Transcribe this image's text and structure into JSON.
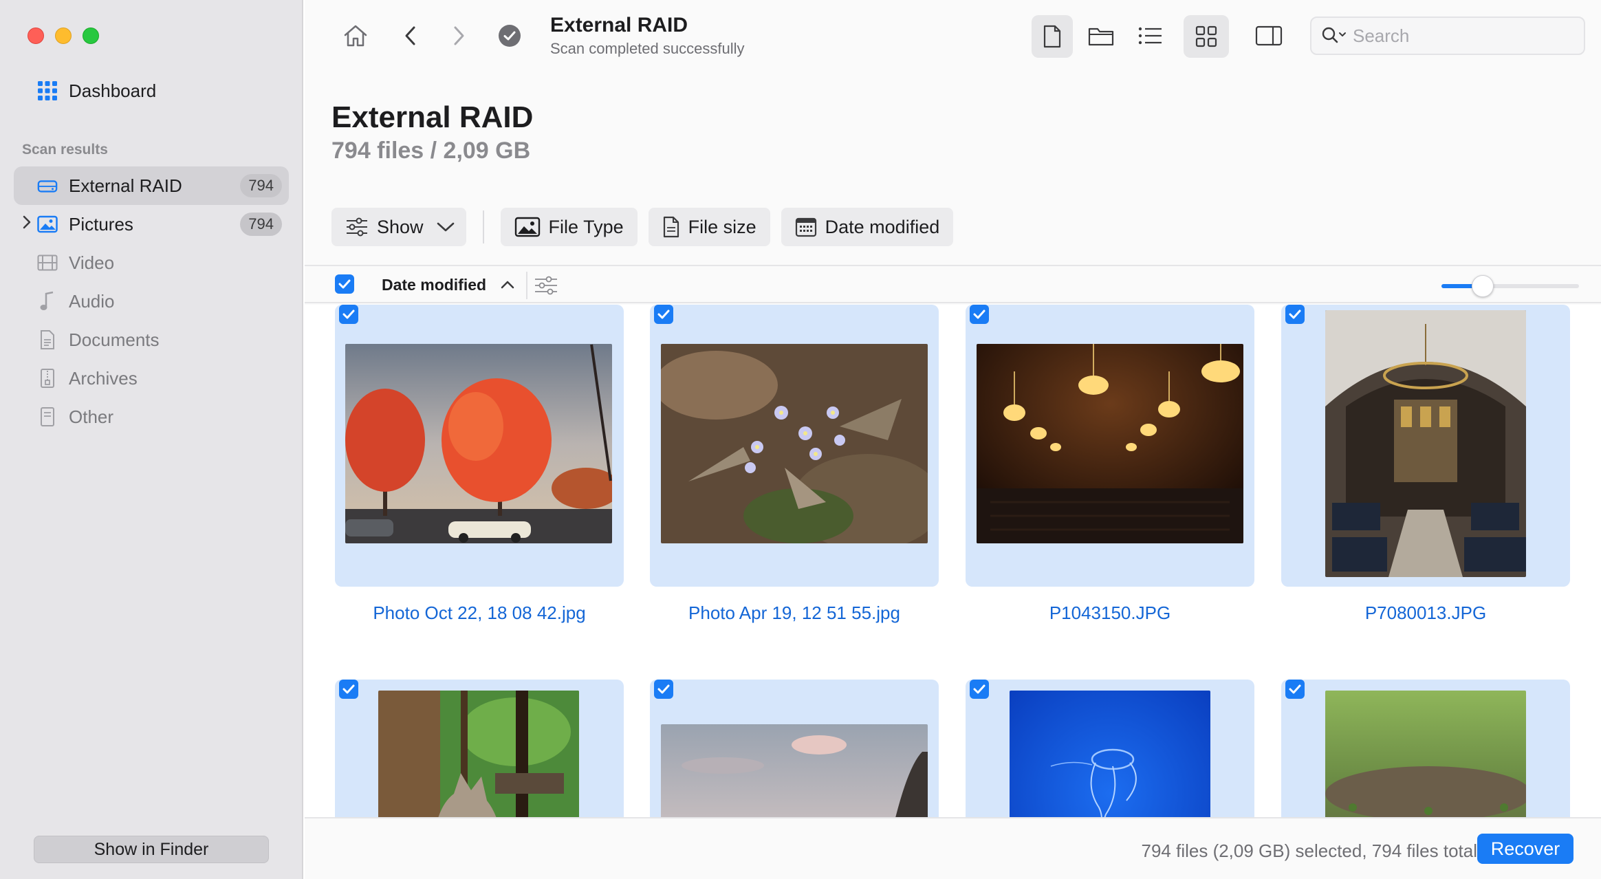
{
  "sidebar": {
    "dashboard": "Dashboard",
    "section_title": "Scan results",
    "items": [
      {
        "label": "External RAID",
        "count": "794"
      },
      {
        "label": "Pictures",
        "count": "794"
      },
      {
        "label": "Video"
      },
      {
        "label": "Audio"
      },
      {
        "label": "Documents"
      },
      {
        "label": "Archives"
      },
      {
        "label": "Other"
      }
    ],
    "show_in_finder": "Show in Finder"
  },
  "toolbar": {
    "title": "External RAID",
    "subtitle": "Scan completed successfully",
    "search_placeholder": "Search"
  },
  "header": {
    "title": "External RAID",
    "subtitle": "794 files / 2,09 GB"
  },
  "filters": {
    "show": "Show",
    "file_type": "File Type",
    "file_size": "File size",
    "date_modified": "Date modified"
  },
  "sort": {
    "label": "Date modified",
    "thumbnail_size": 0.3
  },
  "files": [
    {
      "name": "Photo Oct 22, 18 08 42.jpg"
    },
    {
      "name": "Photo Apr 19, 12 51 55.jpg"
    },
    {
      "name": "P1043150.JPG"
    },
    {
      "name": "P7080013.JPG"
    }
  ],
  "status": {
    "text": "794 files (2,09 GB) selected, 794 files total",
    "recover": "Recover"
  },
  "colors": {
    "accent": "#1a7cf5",
    "tile_bg": "#d6e6fb",
    "link": "#1466d6"
  }
}
